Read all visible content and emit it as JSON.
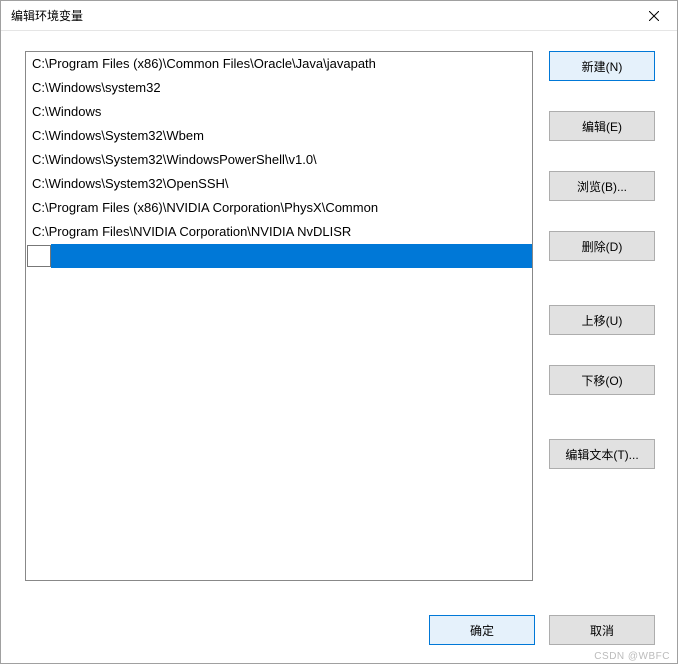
{
  "window": {
    "title": "编辑环境变量"
  },
  "paths": [
    "C:\\Program Files (x86)\\Common Files\\Oracle\\Java\\javapath",
    "C:\\Windows\\system32",
    "C:\\Windows",
    "C:\\Windows\\System32\\Wbem",
    "C:\\Windows\\System32\\WindowsPowerShell\\v1.0\\",
    "C:\\Windows\\System32\\OpenSSH\\",
    "C:\\Program Files (x86)\\NVIDIA Corporation\\PhysX\\Common",
    "C:\\Program Files\\NVIDIA Corporation\\NVIDIA NvDLISR"
  ],
  "editing_value": "",
  "buttons": {
    "new": "新建(N)",
    "edit": "编辑(E)",
    "browse": "浏览(B)...",
    "delete": "删除(D)",
    "move_up": "上移(U)",
    "move_down": "下移(O)",
    "edit_text": "编辑文本(T)...",
    "ok": "确定",
    "cancel": "取消"
  },
  "watermark": "CSDN @WBFC"
}
